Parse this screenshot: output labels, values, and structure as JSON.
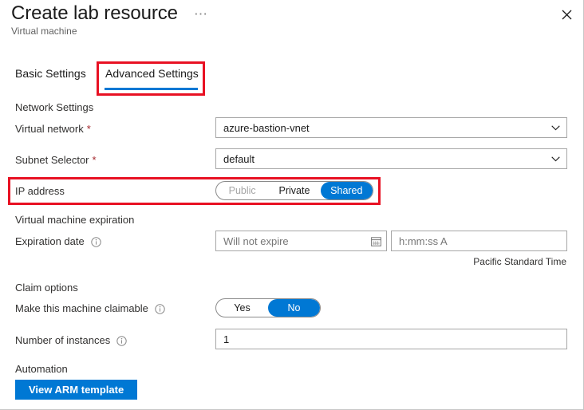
{
  "blade": {
    "title": "Create lab resource",
    "subtitle": "Virtual machine",
    "ellipsis": "⋯",
    "close_icon": "close-icon"
  },
  "tabs": [
    {
      "label": "Basic Settings",
      "selected": false
    },
    {
      "label": "Advanced Settings",
      "selected": true
    }
  ],
  "sections": {
    "network": {
      "heading": "Network Settings",
      "virtual_network": {
        "label": "Virtual network",
        "required": "*",
        "value": "azure-bastion-vnet"
      },
      "subnet_selector": {
        "label": "Subnet Selector",
        "required": "*",
        "value": "default"
      },
      "ip_address": {
        "label": "IP address",
        "options": [
          {
            "label": "Public",
            "state": "disabled"
          },
          {
            "label": "Private",
            "state": "normal"
          },
          {
            "label": "Shared",
            "state": "selected"
          }
        ]
      }
    },
    "expiration": {
      "heading": "Virtual machine expiration",
      "expiration_date": {
        "label": "Expiration date",
        "date_placeholder": "Will not expire",
        "time_placeholder": "h:mm:ss A",
        "calendar_icon": "calendar-icon",
        "info_icon": "info-icon"
      },
      "timezone": "Pacific Standard Time"
    },
    "claim": {
      "heading": "Claim options",
      "claimable": {
        "label": "Make this machine claimable",
        "info_icon": "info-icon",
        "options": [
          {
            "label": "Yes",
            "state": "normal"
          },
          {
            "label": "No",
            "state": "selected"
          }
        ]
      },
      "instances": {
        "label": "Number of instances",
        "info_icon": "info-icon",
        "value": "1"
      }
    },
    "automation": {
      "heading": "Automation",
      "arm_button": "View ARM template"
    }
  },
  "colors": {
    "accent": "#0078d4",
    "highlight": "#e81123",
    "required": "#a4262c",
    "text": "#1b1b1b",
    "muted": "#767676"
  }
}
